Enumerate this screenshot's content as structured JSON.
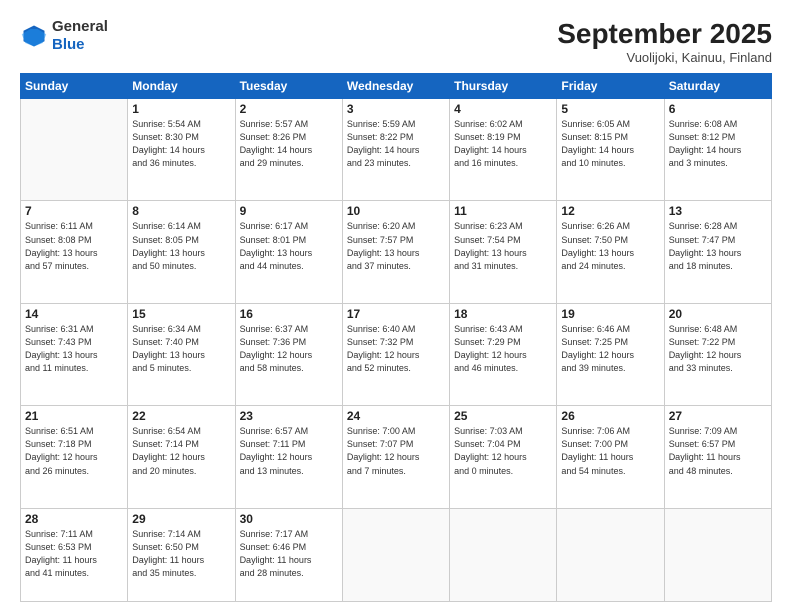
{
  "header": {
    "logo": {
      "general": "General",
      "blue": "Blue"
    },
    "title": "September 2025",
    "subtitle": "Vuolijoki, Kainuu, Finland"
  },
  "days": [
    "Sunday",
    "Monday",
    "Tuesday",
    "Wednesday",
    "Thursday",
    "Friday",
    "Saturday"
  ],
  "weeks": [
    [
      {
        "day": "",
        "info": ""
      },
      {
        "day": "1",
        "info": "Sunrise: 5:54 AM\nSunset: 8:30 PM\nDaylight: 14 hours\nand 36 minutes."
      },
      {
        "day": "2",
        "info": "Sunrise: 5:57 AM\nSunset: 8:26 PM\nDaylight: 14 hours\nand 29 minutes."
      },
      {
        "day": "3",
        "info": "Sunrise: 5:59 AM\nSunset: 8:22 PM\nDaylight: 14 hours\nand 23 minutes."
      },
      {
        "day": "4",
        "info": "Sunrise: 6:02 AM\nSunset: 8:19 PM\nDaylight: 14 hours\nand 16 minutes."
      },
      {
        "day": "5",
        "info": "Sunrise: 6:05 AM\nSunset: 8:15 PM\nDaylight: 14 hours\nand 10 minutes."
      },
      {
        "day": "6",
        "info": "Sunrise: 6:08 AM\nSunset: 8:12 PM\nDaylight: 14 hours\nand 3 minutes."
      }
    ],
    [
      {
        "day": "7",
        "info": "Sunrise: 6:11 AM\nSunset: 8:08 PM\nDaylight: 13 hours\nand 57 minutes."
      },
      {
        "day": "8",
        "info": "Sunrise: 6:14 AM\nSunset: 8:05 PM\nDaylight: 13 hours\nand 50 minutes."
      },
      {
        "day": "9",
        "info": "Sunrise: 6:17 AM\nSunset: 8:01 PM\nDaylight: 13 hours\nand 44 minutes."
      },
      {
        "day": "10",
        "info": "Sunrise: 6:20 AM\nSunset: 7:57 PM\nDaylight: 13 hours\nand 37 minutes."
      },
      {
        "day": "11",
        "info": "Sunrise: 6:23 AM\nSunset: 7:54 PM\nDaylight: 13 hours\nand 31 minutes."
      },
      {
        "day": "12",
        "info": "Sunrise: 6:26 AM\nSunset: 7:50 PM\nDaylight: 13 hours\nand 24 minutes."
      },
      {
        "day": "13",
        "info": "Sunrise: 6:28 AM\nSunset: 7:47 PM\nDaylight: 13 hours\nand 18 minutes."
      }
    ],
    [
      {
        "day": "14",
        "info": "Sunrise: 6:31 AM\nSunset: 7:43 PM\nDaylight: 13 hours\nand 11 minutes."
      },
      {
        "day": "15",
        "info": "Sunrise: 6:34 AM\nSunset: 7:40 PM\nDaylight: 13 hours\nand 5 minutes."
      },
      {
        "day": "16",
        "info": "Sunrise: 6:37 AM\nSunset: 7:36 PM\nDaylight: 12 hours\nand 58 minutes."
      },
      {
        "day": "17",
        "info": "Sunrise: 6:40 AM\nSunset: 7:32 PM\nDaylight: 12 hours\nand 52 minutes."
      },
      {
        "day": "18",
        "info": "Sunrise: 6:43 AM\nSunset: 7:29 PM\nDaylight: 12 hours\nand 46 minutes."
      },
      {
        "day": "19",
        "info": "Sunrise: 6:46 AM\nSunset: 7:25 PM\nDaylight: 12 hours\nand 39 minutes."
      },
      {
        "day": "20",
        "info": "Sunrise: 6:48 AM\nSunset: 7:22 PM\nDaylight: 12 hours\nand 33 minutes."
      }
    ],
    [
      {
        "day": "21",
        "info": "Sunrise: 6:51 AM\nSunset: 7:18 PM\nDaylight: 12 hours\nand 26 minutes."
      },
      {
        "day": "22",
        "info": "Sunrise: 6:54 AM\nSunset: 7:14 PM\nDaylight: 12 hours\nand 20 minutes."
      },
      {
        "day": "23",
        "info": "Sunrise: 6:57 AM\nSunset: 7:11 PM\nDaylight: 12 hours\nand 13 minutes."
      },
      {
        "day": "24",
        "info": "Sunrise: 7:00 AM\nSunset: 7:07 PM\nDaylight: 12 hours\nand 7 minutes."
      },
      {
        "day": "25",
        "info": "Sunrise: 7:03 AM\nSunset: 7:04 PM\nDaylight: 12 hours\nand 0 minutes."
      },
      {
        "day": "26",
        "info": "Sunrise: 7:06 AM\nSunset: 7:00 PM\nDaylight: 11 hours\nand 54 minutes."
      },
      {
        "day": "27",
        "info": "Sunrise: 7:09 AM\nSunset: 6:57 PM\nDaylight: 11 hours\nand 48 minutes."
      }
    ],
    [
      {
        "day": "28",
        "info": "Sunrise: 7:11 AM\nSunset: 6:53 PM\nDaylight: 11 hours\nand 41 minutes."
      },
      {
        "day": "29",
        "info": "Sunrise: 7:14 AM\nSunset: 6:50 PM\nDaylight: 11 hours\nand 35 minutes."
      },
      {
        "day": "30",
        "info": "Sunrise: 7:17 AM\nSunset: 6:46 PM\nDaylight: 11 hours\nand 28 minutes."
      },
      {
        "day": "",
        "info": ""
      },
      {
        "day": "",
        "info": ""
      },
      {
        "day": "",
        "info": ""
      },
      {
        "day": "",
        "info": ""
      }
    ]
  ]
}
